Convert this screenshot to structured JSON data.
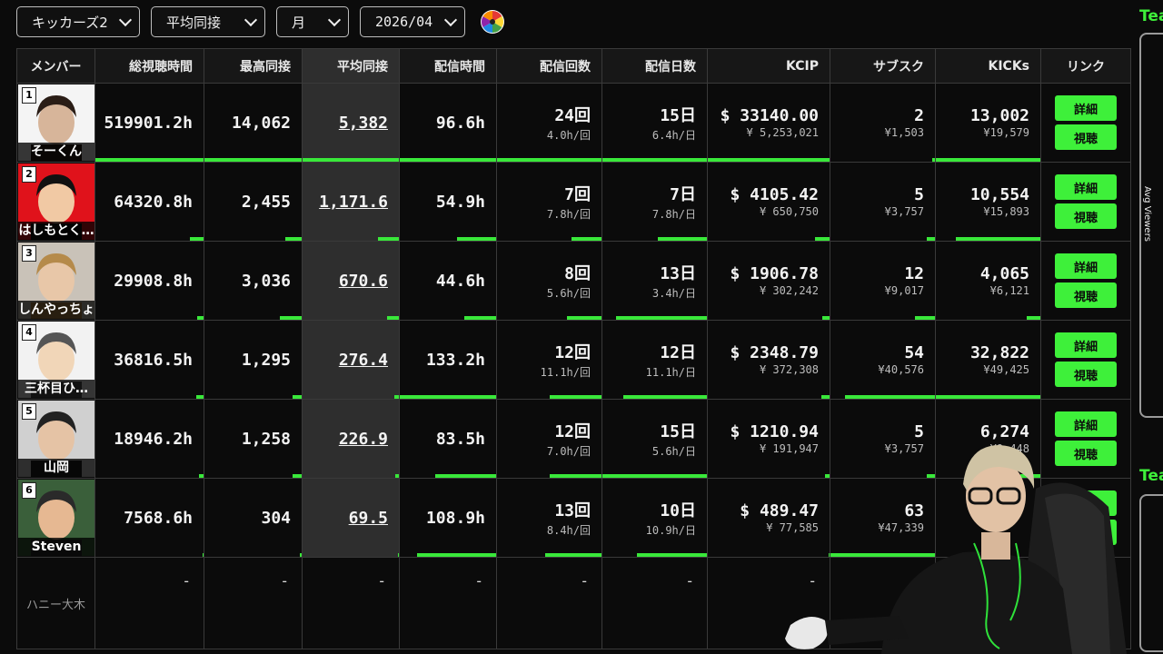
{
  "filters": {
    "group": "キッカーズ2",
    "metric": "平均同接",
    "period": "月",
    "month": "2026/04"
  },
  "headers": [
    "メンバー",
    "総視聴時間",
    "最高同接",
    "平均同接",
    "配信時間",
    "配信回数",
    "配信日数",
    "KCIP",
    "サブスク",
    "KICKs",
    "リンク"
  ],
  "rows": [
    {
      "rank": "1",
      "name": "そーくん",
      "total_watch": "519901.2h",
      "peak": "14,062",
      "avg": "5,382",
      "stream_time": "96.6h",
      "count": "24回",
      "count_sub": "4.0h/回",
      "days": "15日",
      "days_sub": "6.4h/日",
      "kcip": "$ 33140.00",
      "kcip_sub": "¥ 5,253,021",
      "subs": "2",
      "subs_sub": "¥1,503",
      "kicks": "13,002",
      "kicks_sub": "¥19,579",
      "detail": "詳細",
      "watch": "視聴",
      "bars": [
        1,
        1,
        1,
        1,
        1,
        1,
        1,
        0.03,
        1
      ]
    },
    {
      "rank": "2",
      "name": "はしもとく…",
      "total_watch": "64320.8h",
      "peak": "2,455",
      "avg": "1,171.6",
      "stream_time": "54.9h",
      "count": "7回",
      "count_sub": "7.8h/回",
      "days": "7日",
      "days_sub": "7.8h/日",
      "kcip": "$ 4105.42",
      "kcip_sub": "¥ 650,750",
      "subs": "5",
      "subs_sub": "¥3,757",
      "kicks": "10,554",
      "kicks_sub": "¥15,893",
      "detail": "詳細",
      "watch": "視聴",
      "bars": [
        0.13,
        0.17,
        0.22,
        0.41,
        0.29,
        0.47,
        0.12,
        0.08,
        0.81
      ]
    },
    {
      "rank": "3",
      "name": "しんやっちょ",
      "total_watch": "29908.8h",
      "peak": "3,036",
      "avg": "670.6",
      "stream_time": "44.6h",
      "count": "8回",
      "count_sub": "5.6h/回",
      "days": "13日",
      "days_sub": "3.4h/日",
      "kcip": "$ 1906.78",
      "kcip_sub": "¥ 302,242",
      "subs": "12",
      "subs_sub": "¥9,017",
      "kicks": "4,065",
      "kicks_sub": "¥6,121",
      "detail": "詳細",
      "watch": "視聴",
      "bars": [
        0.06,
        0.22,
        0.12,
        0.33,
        0.33,
        0.87,
        0.06,
        0.19,
        0.13
      ]
    },
    {
      "rank": "4",
      "name": "三杯目ひ…",
      "total_watch": "36816.5h",
      "peak": "1,295",
      "avg": "276.4",
      "stream_time": "133.2h",
      "count": "12回",
      "count_sub": "11.1h/回",
      "days": "12日",
      "days_sub": "11.1h/日",
      "kcip": "$ 2348.79",
      "kcip_sub": "¥ 372,308",
      "subs": "54",
      "subs_sub": "¥40,576",
      "kicks": "32,822",
      "kicks_sub": "¥49,425",
      "detail": "詳細",
      "watch": "視聴",
      "bars": [
        0.07,
        0.09,
        0.05,
        1,
        0.5,
        0.8,
        0.07,
        0.86,
        1
      ]
    },
    {
      "rank": "5",
      "name": "山岡",
      "total_watch": "18946.2h",
      "peak": "1,258",
      "avg": "226.9",
      "stream_time": "83.5h",
      "count": "12回",
      "count_sub": "7.0h/回",
      "days": "15日",
      "days_sub": "5.6h/日",
      "kcip": "$ 1210.94",
      "kcip_sub": "¥ 191,947",
      "subs": "5",
      "subs_sub": "¥3,757",
      "kicks": "6,274",
      "kicks_sub": "¥9,448",
      "detail": "詳細",
      "watch": "視聴",
      "bars": [
        0.04,
        0.09,
        0.04,
        0.63,
        0.5,
        1,
        0.04,
        0.08,
        0.19
      ]
    },
    {
      "rank": "6",
      "name": "Steven",
      "total_watch": "7568.6h",
      "peak": "304",
      "avg": "69.5",
      "stream_time": "108.9h",
      "count": "13回",
      "count_sub": "8.4h/回",
      "days": "10日",
      "days_sub": "10.9h/日",
      "kcip": "$ 489.47",
      "kcip_sub": "¥ 77,585",
      "subs": "63",
      "subs_sub": "¥47,339",
      "kicks": "",
      "kicks_sub": "",
      "detail": "詳細",
      "watch": "視聴",
      "bars": [
        0.01,
        0.02,
        0.01,
        0.82,
        0.54,
        0.67,
        0.01,
        1,
        0
      ]
    }
  ],
  "empty_row": {
    "name": "ハニー大木",
    "dash": "-"
  },
  "side": {
    "title1": "Tea",
    "title2": "Tea",
    "vertical_label": "Avg Viewers"
  },
  "colors": {
    "accent": "#3ef03a",
    "bar": "#39e83a",
    "highlight_col": "#2e2e2e",
    "background": "#0b0b0b"
  }
}
